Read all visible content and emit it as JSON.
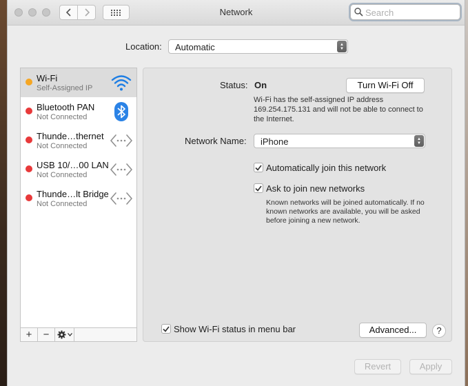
{
  "window": {
    "title": "Network"
  },
  "search": {
    "placeholder": "Search"
  },
  "location": {
    "label": "Location:",
    "value": "Automatic"
  },
  "services": [
    {
      "name": "Wi-Fi",
      "status": "Self-Assigned IP",
      "dot_color": "#f5a623",
      "icon": "wifi-icon",
      "selected": true
    },
    {
      "name": "Bluetooth PAN",
      "status": "Not Connected",
      "dot_color": "#e8393a",
      "icon": "bluetooth-icon"
    },
    {
      "name": "Thunde…thernet",
      "status": "Not Connected",
      "dot_color": "#e8393a",
      "icon": "ethernet-arrows-icon"
    },
    {
      "name": "USB 10/…00 LAN",
      "status": "Not Connected",
      "dot_color": "#e8393a",
      "icon": "ethernet-arrows-icon"
    },
    {
      "name": "Thunde…lt Bridge",
      "status": "Not Connected",
      "dot_color": "#e8393a",
      "icon": "ethernet-arrows-icon"
    }
  ],
  "sidebar_controls": {
    "add": "+",
    "remove": "−"
  },
  "detail": {
    "status_label": "Status:",
    "status_value": "On",
    "toggle_button": "Turn Wi-Fi Off",
    "status_description": "Wi-Fi has the self-assigned IP address 169.254.175.131 and will not be able to connect to the Internet.",
    "network_name_label": "Network Name:",
    "network_name_value": "iPhone",
    "auto_join_label": "Automatically join this network",
    "auto_join_checked": true,
    "ask_join_label": "Ask to join new networks",
    "ask_join_checked": true,
    "ask_join_description": "Known networks will be joined automatically. If no known networks are available, you will be asked before joining a new network.",
    "show_status_label": "Show Wi-Fi status in menu bar",
    "show_status_checked": true,
    "advanced_button": "Advanced...",
    "help_button": "?"
  },
  "footer": {
    "revert": "Revert",
    "apply": "Apply"
  },
  "colors": {
    "accent_blue": "#2f7ff2",
    "wifi_blue": "#1e7ee4"
  }
}
